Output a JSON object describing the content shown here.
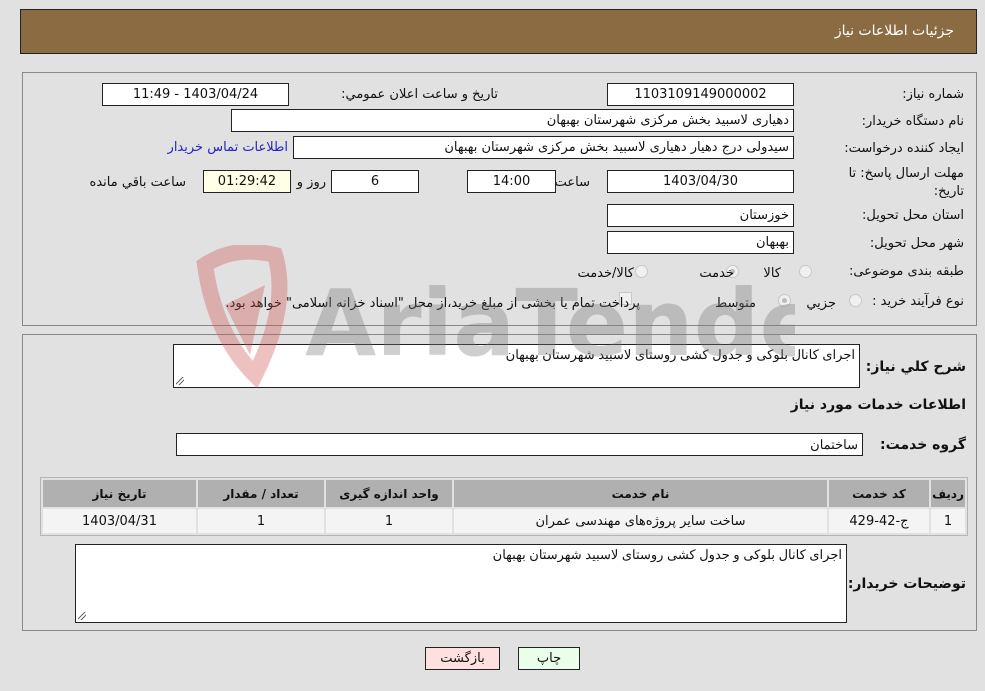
{
  "header": {
    "title": "جزئیات اطلاعات نیاز"
  },
  "form": {
    "need_number": {
      "label": "شماره نیاز:",
      "value": "1103109149000002"
    },
    "announce_datetime": {
      "label": "تاریخ و ساعت اعلان عمومي:",
      "value": "1403/04/24 - 11:49"
    },
    "buyer_org": {
      "label": "نام دستگاه خریدار:",
      "value": "دهیاری لاسبید بخش مرکزی شهرستان بهبهان"
    },
    "requester": {
      "label": "ایجاد کننده درخواست:",
      "value": "سیدولی درج دهیار دهیاری لاسبید بخش مرکزی شهرستان بهبهان"
    },
    "buyer_contact_link": "اطلاعات تماس خریدار",
    "deadline": {
      "label": "مهلت ارسال پاسخ: تا تاریخ:",
      "date": "1403/04/30",
      "time_label": "ساعت",
      "time": "14:00",
      "days": "6",
      "days_label": "روز و",
      "remaining": "01:29:42",
      "remaining_label": "ساعت باقي مانده"
    },
    "province": {
      "label": "استان محل تحویل:",
      "value": "خوزستان"
    },
    "city": {
      "label": "شهر محل تحویل:",
      "value": "بهبهان"
    },
    "category": {
      "label": "طبقه بندی موضوعی:",
      "options": [
        "کالا",
        "خدمت",
        "کالا/خدمت"
      ],
      "selected": "خدمت"
    },
    "purchase_type": {
      "label": "نوع فرآیند خرید :",
      "options": [
        "جزيي",
        "متوسط"
      ],
      "selected": "متوسط",
      "treasury_checkbox_label": "پرداخت تمام یا بخشی از مبلغ خرید،از محل \"اسناد خزانه اسلامی\" خواهد بود.",
      "treasury_checked": false
    }
  },
  "details": {
    "description_label": "شرح کلي نیاز:",
    "description": "اجرای کانال بلوکی و جدول کشی روستای لاسبید شهرستان بهبهان",
    "services_title": "اطلاعات خدمات مورد نیاز",
    "service_group_label": "گروه خدمت:",
    "service_group": "ساختمان",
    "table": {
      "headers": [
        "ردیف",
        "کد خدمت",
        "نام خدمت",
        "واحد اندازه گیری",
        "تعداد / مقدار",
        "تاریخ نیاز"
      ],
      "rows": [
        [
          "1",
          "ج-42-429",
          "ساخت سایر پروژه‌های مهندسی عمران",
          "1",
          "1",
          "1403/04/31"
        ]
      ]
    },
    "buyer_notes_label": "توضیحات خریدار:",
    "buyer_notes": "اجرای کانال بلوکی و جدول کشی روستای لاسبید شهرستان بهبهان"
  },
  "buttons": {
    "print": "چاپ",
    "back": "بازگشت"
  },
  "colors": {
    "header_bg": "#8b6b42",
    "print_bg": "#eaffea",
    "back_bg": "#ffe0e0",
    "link": "#2323c8"
  },
  "watermark": "AriaTender.neT"
}
